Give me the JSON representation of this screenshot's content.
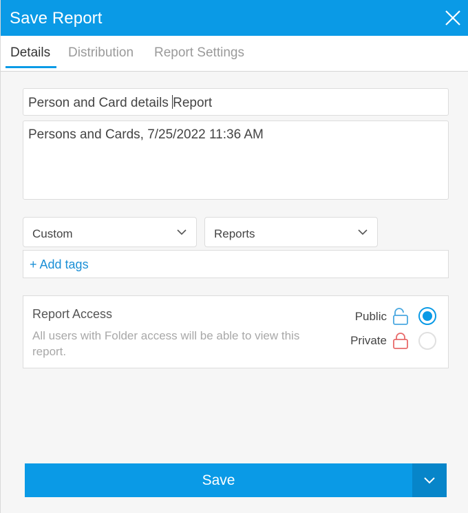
{
  "dialog": {
    "title": "Save Report"
  },
  "tabs": [
    {
      "label": "Details",
      "active": true
    },
    {
      "label": "Distribution",
      "active": false
    },
    {
      "label": "Report Settings",
      "active": false
    }
  ],
  "form": {
    "name_value_before_cursor": "Person and Card details ",
    "name_value_after_cursor": "Report",
    "description_value": "Persons and Cards, 7/25/2022 11:36 AM",
    "category_selected": "Custom",
    "folder_selected": "Reports",
    "add_tags_label": "+ Add tags"
  },
  "access": {
    "heading": "Report Access",
    "description": "All users with Folder access will be able to view this report.",
    "options": [
      {
        "label": "Public",
        "icon": "unlocked-padlock-icon",
        "selected": true,
        "color": "#4aa8e0"
      },
      {
        "label": "Private",
        "icon": "locked-padlock-icon",
        "selected": false,
        "color": "#e86a6a"
      }
    ]
  },
  "actions": {
    "save_label": "Save"
  },
  "colors": {
    "accent": "#0a9ae6",
    "link": "#1a8fd6"
  }
}
